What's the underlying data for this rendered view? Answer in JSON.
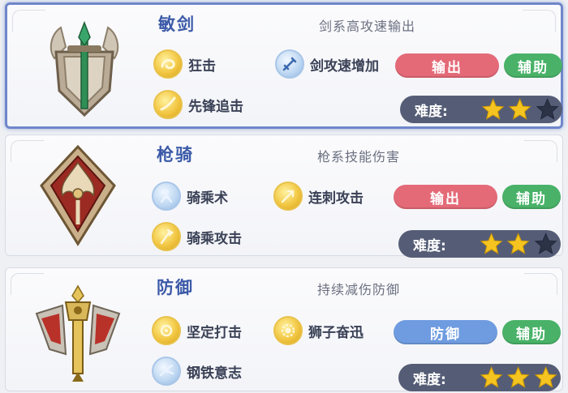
{
  "classes": [
    {
      "name": "敏剑",
      "description": "剑系高攻速输出",
      "selected": true,
      "emblem_icon": "sword-shield-emblem-icon",
      "skills": [
        {
          "label": "狂击",
          "icon": "swirl-gold-icon",
          "style": "gold"
        },
        {
          "label": "剑攻速增加",
          "icon": "blue-sword-buff-icon",
          "style": "blue"
        },
        {
          "label": "先锋追击",
          "icon": "slash-gold-icon",
          "style": "gold"
        }
      ],
      "roles": [
        {
          "label": "输出",
          "color": "#e46a78"
        },
        {
          "label": "辅助",
          "color": "#49b268"
        }
      ],
      "difficulty_label": "难度:",
      "difficulty_stars": 2,
      "difficulty_max": 3
    },
    {
      "name": "枪骑",
      "description": "枪系技能伤害",
      "selected": false,
      "emblem_icon": "spear-red-emblem-icon",
      "skills": [
        {
          "label": "骑乘术",
          "icon": "mounted-rider-icon",
          "style": "blue"
        },
        {
          "label": "连刺攻击",
          "icon": "spear-thrust-gold-icon",
          "style": "gold"
        },
        {
          "label": "骑乘攻击",
          "icon": "lance-gold-icon",
          "style": "gold"
        }
      ],
      "roles": [
        {
          "label": "输出",
          "color": "#e46a78"
        },
        {
          "label": "辅助",
          "color": "#49b268"
        }
      ],
      "difficulty_label": "难度:",
      "difficulty_stars": 2,
      "difficulty_max": 3
    },
    {
      "name": "防御",
      "description": "持续减伤防御",
      "selected": false,
      "emblem_icon": "mace-shield-emblem-icon",
      "skills": [
        {
          "label": "坚定打击",
          "icon": "fist-gold-icon",
          "style": "gold"
        },
        {
          "label": "狮子奋迅",
          "icon": "lion-gold-icon",
          "style": "gold"
        },
        {
          "label": "钢铁意志",
          "icon": "steel-will-blue-icon",
          "style": "blue"
        }
      ],
      "roles": [
        {
          "label": "防御",
          "color": "#6f9ce0"
        },
        {
          "label": "辅助",
          "color": "#49b268"
        }
      ],
      "difficulty_label": "难度:",
      "difficulty_stars": 3,
      "difficulty_max": 3
    }
  ]
}
